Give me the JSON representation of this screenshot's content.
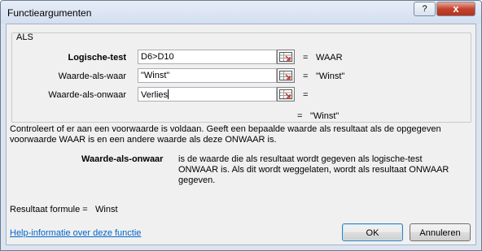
{
  "window": {
    "title": "Functieargumenten",
    "help_button": "?",
    "close_button": "x"
  },
  "function": {
    "name": "ALS",
    "arguments": [
      {
        "label": "Logische-test",
        "value": "D6>D10",
        "result": "WAAR",
        "bold": true
      },
      {
        "label": "Waarde-als-waar",
        "value": "\"Winst\"",
        "result": "\"Winst\"",
        "bold": false
      },
      {
        "label": "Waarde-als-onwaar",
        "value": "Verlies",
        "result": "",
        "bold": false
      }
    ],
    "result": "\"Winst\""
  },
  "description": {
    "function_text": "Controleert of er aan een voorwaarde is voldaan. Geeft een bepaalde waarde als resultaat als de opgegeven voorwaarde WAAR is en een andere waarde als deze ONWAAR is.",
    "arg_name": "Waarde-als-onwaar",
    "arg_text": "is de waarde die als resultaat wordt gegeven als logische-test ONWAAR is. Als dit wordt weggelaten, wordt als resultaat ONWAAR gegeven."
  },
  "footer": {
    "formula_label": "Resultaat formule =",
    "formula_value": "Winst",
    "help_link": "Help-informatie over deze functie",
    "ok_label": "OK",
    "cancel_label": "Annuleren"
  },
  "equals_sign": "=",
  "icons": {
    "ref_button": "collapse-dialog-icon"
  }
}
